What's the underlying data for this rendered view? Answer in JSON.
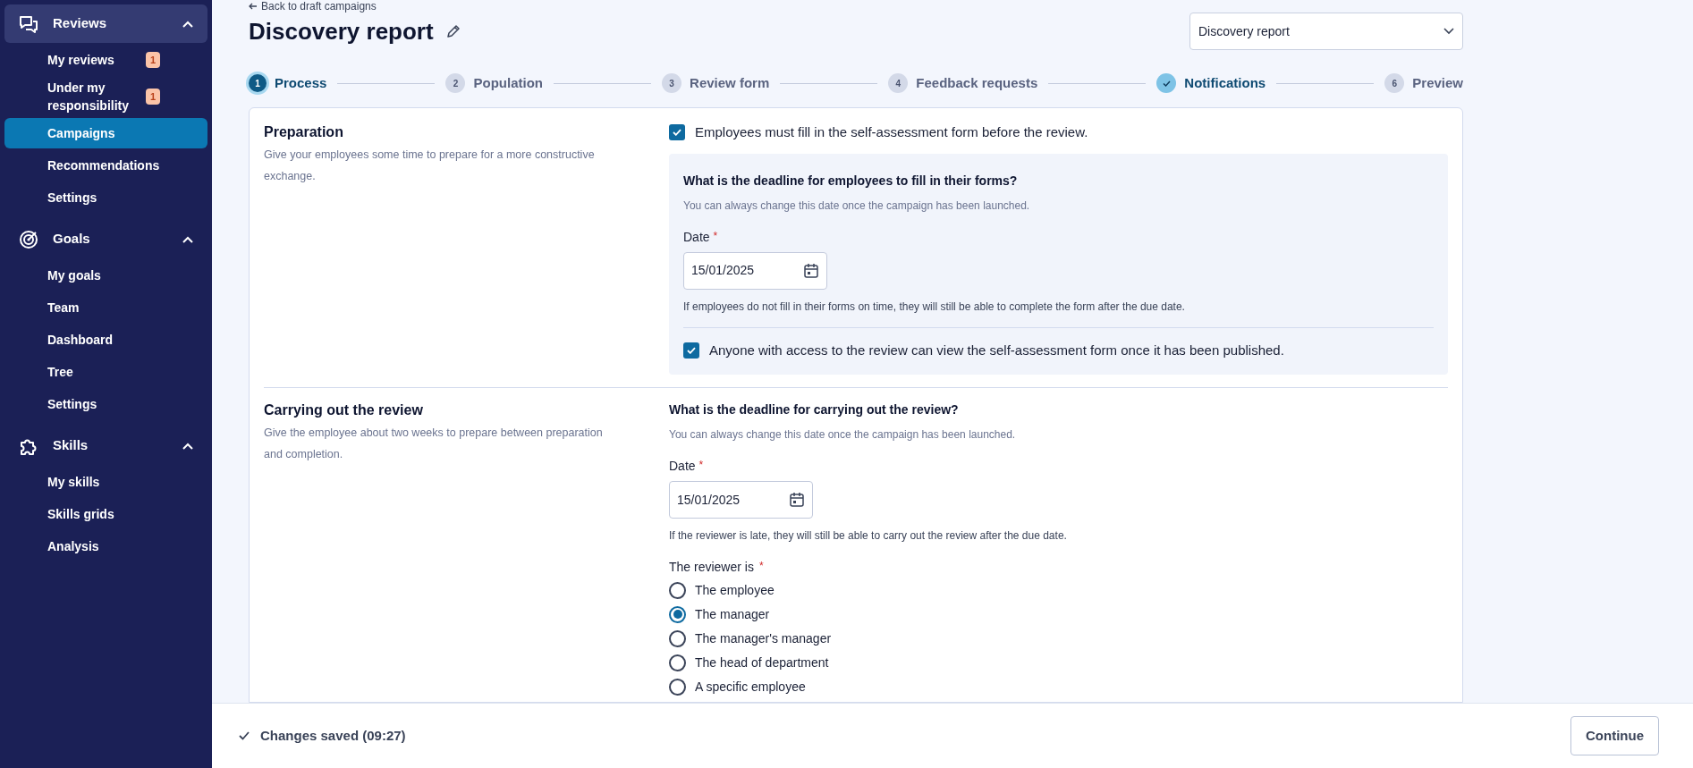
{
  "sidebar": {
    "sections": [
      {
        "title": "Reviews",
        "expanded": true,
        "hovered": true,
        "items": [
          {
            "label": "My reviews",
            "badge": "1",
            "selected": false
          },
          {
            "label": "Under my responsibility",
            "badge": "1",
            "selected": false
          },
          {
            "label": "Campaigns",
            "selected": true
          },
          {
            "label": "Recommendations",
            "selected": false
          },
          {
            "label": "Settings",
            "selected": false
          }
        ]
      },
      {
        "title": "Goals",
        "expanded": true,
        "hovered": false,
        "items": [
          {
            "label": "My goals",
            "selected": false
          },
          {
            "label": "Team",
            "selected": false
          },
          {
            "label": "Dashboard",
            "selected": false
          },
          {
            "label": "Tree",
            "selected": false
          },
          {
            "label": "Settings",
            "selected": false
          }
        ]
      },
      {
        "title": "Skills",
        "expanded": true,
        "hovered": false,
        "items": [
          {
            "label": "My skills",
            "selected": false
          },
          {
            "label": "Skills grids",
            "selected": false
          },
          {
            "label": "Analysis",
            "selected": false
          }
        ]
      }
    ]
  },
  "back_link": "Back to draft campaigns",
  "title": "Discovery report",
  "report_select": {
    "value": "Discovery report"
  },
  "steps": [
    {
      "number": "1",
      "label": "Process",
      "selected": true,
      "completed": false
    },
    {
      "number": "2",
      "label": "Population",
      "selected": false,
      "completed": false
    },
    {
      "number": "3",
      "label": "Review form",
      "selected": false,
      "completed": false
    },
    {
      "number": "4",
      "label": "Feedback requests",
      "selected": false,
      "completed": false
    },
    {
      "label": "Notifications",
      "selected": false,
      "completed": true
    },
    {
      "number": "6",
      "label": "Preview",
      "selected": false,
      "completed": false
    }
  ],
  "preparation": {
    "title": "Preparation",
    "description": "Give your employees some time to prepare for a more constructive exchange.",
    "self_assessment": {
      "label": "Employees must fill in the self-assessment form before the review.",
      "checked": true
    },
    "question": "What is the deadline for employees to fill in their forms?",
    "hint": "You can always change this date once the campaign has been launched.",
    "date_label": "Date",
    "required_mark": "*",
    "date": "15/01/2025",
    "note": "If employees do not fill in their forms on time, they will still be able to complete the form after the due date.",
    "visibility": {
      "label": "Anyone with access to the review can view the self-assessment form once it has been published.",
      "checked": true
    }
  },
  "carrying_out": {
    "title": "Carrying out the review",
    "description": "Give the employee about two weeks to prepare between preparation and completion.",
    "question": "What is the deadline for carrying out the review?",
    "hint": "You can always change this date once the campaign has been launched.",
    "date_label": "Date",
    "required_mark": "*",
    "date": "15/01/2025",
    "note": "If the reviewer is late, they will still be able to carry out the review after the due date.",
    "reviewer_label": "The reviewer is",
    "reviewer_required_mark": "*",
    "reviewer_options": [
      {
        "label": "The employee",
        "selected": false
      },
      {
        "label": "The manager",
        "selected": true
      },
      {
        "label": "The manager's manager",
        "selected": false
      },
      {
        "label": "The head of department",
        "selected": false
      },
      {
        "label": "A specific employee",
        "selected": false
      }
    ]
  },
  "footer": {
    "status": "Changes saved (09:27)",
    "button": "Continue"
  }
}
